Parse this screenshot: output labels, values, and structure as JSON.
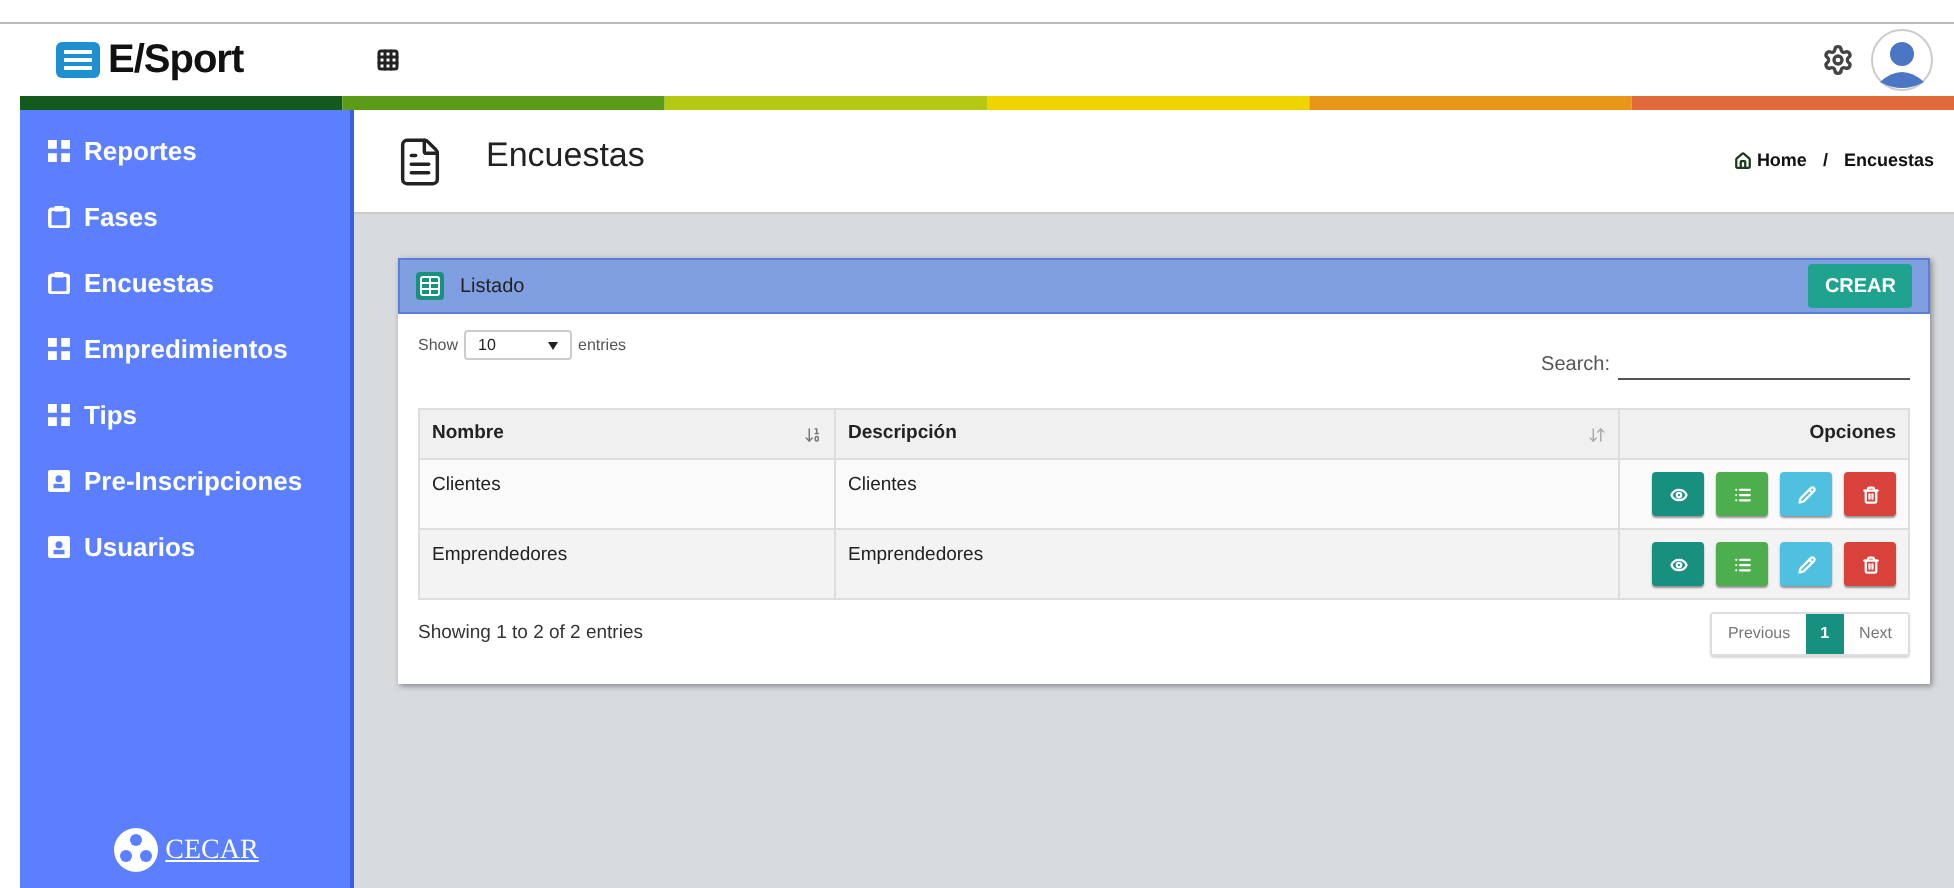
{
  "header": {
    "brand": "E/Sport"
  },
  "sidebar": {
    "items": [
      {
        "label": "Reportes",
        "kind": "grid"
      },
      {
        "label": "Fases",
        "kind": "clipboard"
      },
      {
        "label": "Encuestas",
        "kind": "clipboard"
      },
      {
        "label": "Empredimientos",
        "kind": "grid"
      },
      {
        "label": "Tips",
        "kind": "grid"
      },
      {
        "label": "Pre-Inscripciones",
        "kind": "contact"
      },
      {
        "label": "Usuarios",
        "kind": "contact"
      }
    ],
    "logo": "CECAR"
  },
  "page": {
    "title": "Encuestas",
    "breadcrumb": [
      "Home",
      "/",
      "Encuestas"
    ]
  },
  "panel": {
    "title": "Listado",
    "create_button": "CREAR",
    "length": {
      "before": "Show",
      "value": "10",
      "after": "entries"
    },
    "search_label": "Search:",
    "table": {
      "columns": [
        "Nombre",
        "Descripción",
        "Opciones"
      ],
      "rows": [
        {
          "cells": [
            "Clientes",
            "Clientes"
          ]
        },
        {
          "cells": [
            "Emprendedores",
            "Emprendedores"
          ]
        }
      ]
    },
    "info": "Showing 1 to 2 of 2 entries",
    "pagination": [
      {
        "label": "Previous",
        "selected": false
      },
      {
        "label": "1",
        "selected": true
      },
      {
        "label": "Next",
        "selected": false
      }
    ]
  }
}
